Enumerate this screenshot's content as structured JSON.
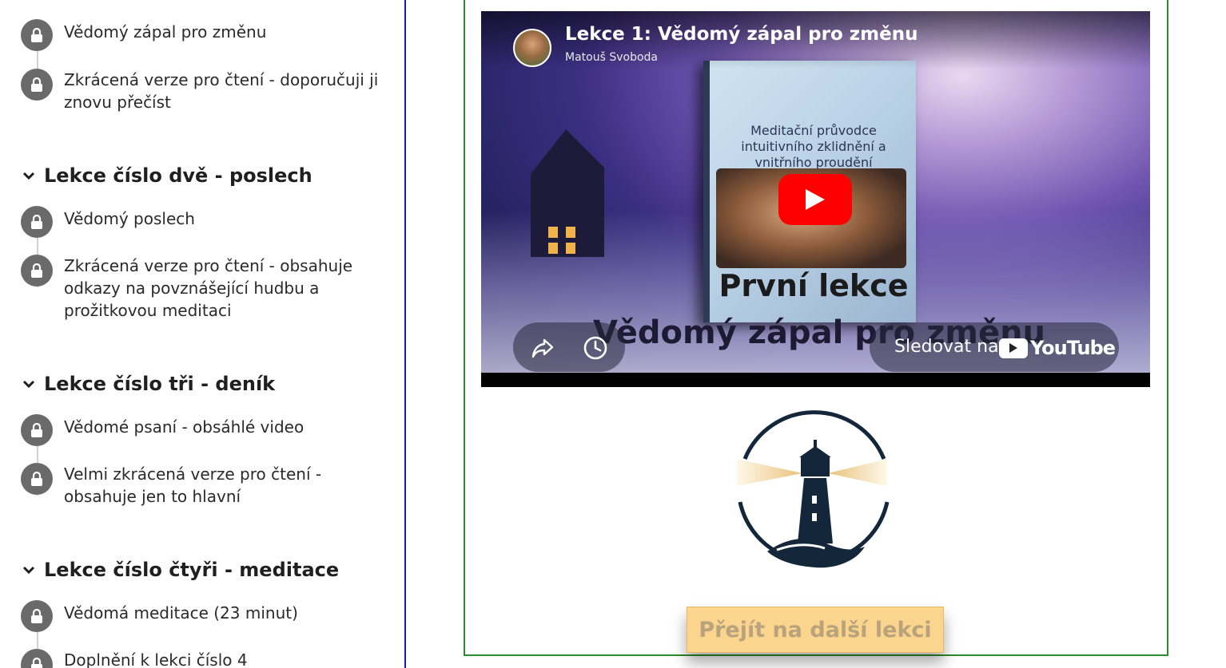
{
  "sidebar": {
    "groups": [
      {
        "lessons": [
          {
            "label": "Vědomý zápal pro změnu"
          },
          {
            "label": "Zkrácená verze pro čtení - doporučuji ji znovu přečíst"
          }
        ]
      },
      {
        "title": "Lekce číslo dvě - poslech",
        "lessons": [
          {
            "label": "Vědomý poslech"
          },
          {
            "label": "Zkrácená verze pro čtení - obsahuje odkazy na povznášející hudbu a prožitkovou meditaci"
          }
        ]
      },
      {
        "title": "Lekce číslo tři - deník",
        "lessons": [
          {
            "label": "Vědomé psaní - obsáhlé video"
          },
          {
            "label": "Velmi zkrácená verze pro čtení - obsahuje jen to hlavní"
          }
        ]
      },
      {
        "title": "Lekce číslo čtyři - meditace",
        "lessons": [
          {
            "label": "Vědomá meditace (23 minut)"
          },
          {
            "label": "Doplnění k lekci číslo 4"
          }
        ]
      }
    ]
  },
  "video": {
    "title": "Lekce 1: Vědomý zápal pro změnu",
    "channel": "Matouš Svoboda",
    "book_subtitle": "Meditační průvodce intuitivního zklidnění a vnitřního proudění",
    "book_title": "První lekce",
    "overlay_title": "Vědomý zápal pro změnu",
    "watch_on": "Sledovat na",
    "youtube_word": "YouTube"
  },
  "next_button": {
    "label": "Přejít na další lekci"
  },
  "colors": {
    "sidebar_border": "#1a1aa8",
    "main_border": "#2d8a2d",
    "lock_bg": "#6a6a6a",
    "button_bg": "#fbd58d",
    "youtube_red": "#ff0000",
    "logo_navy": "#13263a"
  },
  "icons": [
    "lock-icon",
    "chevron-down-icon",
    "share-icon",
    "clock-icon",
    "play-icon",
    "youtube-logo",
    "lighthouse-logo"
  ]
}
